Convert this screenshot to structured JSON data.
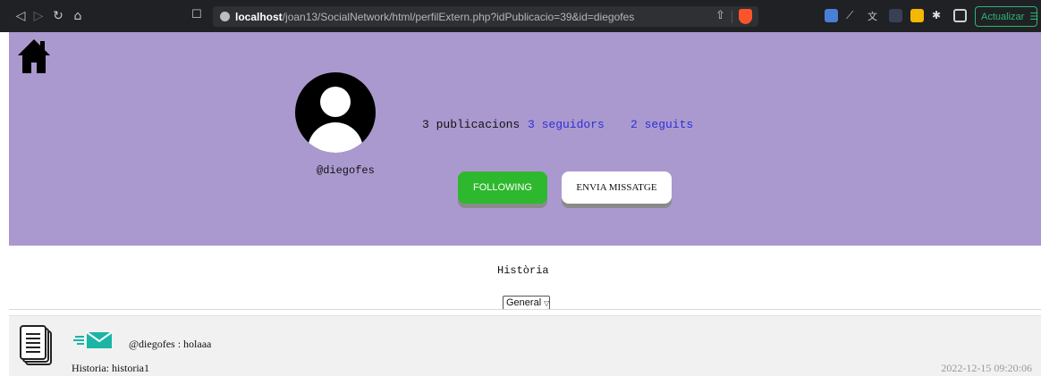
{
  "browser": {
    "url_host": "localhost",
    "url_path": "/joan13/SocialNetwork/html/perfilExtern.php?idPublicacio=39&id=diegofes",
    "update_label": "Actualizar",
    "icons": [
      "back-icon",
      "forward-icon",
      "reload-icon",
      "home-icon",
      "bookmark-icon",
      "share-icon",
      "brave-shield-icon",
      "extension-icon",
      "sidebar-icon",
      "menu-icon"
    ]
  },
  "profile": {
    "username": "@diegofes",
    "publications": "3 publicacions",
    "followers": "3 seguidors",
    "following": "2 seguits",
    "following_button": "FOLLOWING",
    "message_button": "ENVIA MISSATGE",
    "colors": {
      "header_bg": "#aa99cf",
      "following_btn": "#2eb82e",
      "link": "#2f2fd6"
    }
  },
  "history": {
    "title": "Història",
    "filter_selected": "General"
  },
  "posts": [
    {
      "author_text": "@diegofes : holaaa",
      "story": "Historia: historia1",
      "date": "2022-12-15 09:20:06"
    }
  ]
}
